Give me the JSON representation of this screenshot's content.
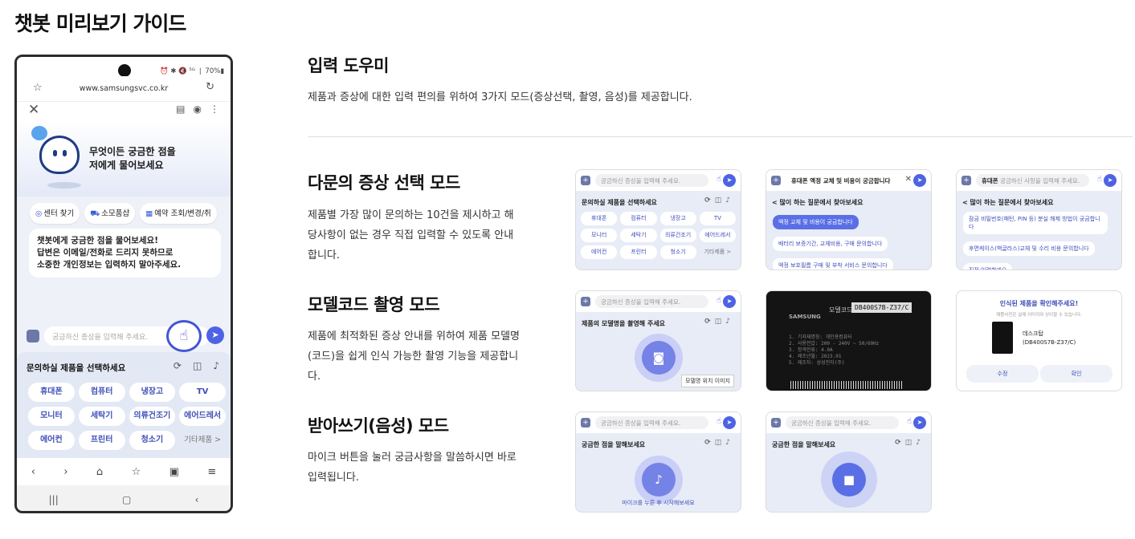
{
  "page_title": "챗봇 미리보기 가이드",
  "phone": {
    "status_right": "⏰ ✱ 🔇 ⁵ᴳ ❘ 70%▮",
    "url": "www.samsungsvc.co.kr",
    "hero_text_1": "무엇이든 궁금한 점을",
    "hero_text_2": "저에게 물어보세요",
    "quick_chips": [
      "센터 찾기",
      "소모품샵",
      "예약 조회/변경/취"
    ],
    "bot_message_1": "챗봇에게 궁금한 점을 물어보세요!",
    "bot_message_2": "답변은 이메일/전화로 드리지 못하므로",
    "bot_message_3": "소중한 개인정보는 입력하지 말아주세요.",
    "input_placeholder": "궁금하신 증상을 입력해 주세요.",
    "panel_title": "문의하실 제품을 선택하세요",
    "products": [
      "휴대폰",
      "컴퓨터",
      "냉장고",
      "TV",
      "모니터",
      "세탁기",
      "의류건조기",
      "에어드레서",
      "에어컨",
      "프린터",
      "청소기",
      "기타제품 >"
    ]
  },
  "sections": {
    "input_helper": {
      "title": "입력 도우미",
      "desc": "제품과 증상에 대한 입력 편의를 위하여 3가지 모드(증상선택, 촬영, 음성)를 제공합니다."
    },
    "symptom_mode": {
      "title": "다문의 증상 선택 모드",
      "desc": "제품별 가장 많이 문의하는 10건을 제시하고 해당사항이 없는 경우 직접 입력할 수 있도록 안내합니다."
    },
    "model_mode": {
      "title": "모델코드 촬영 모드",
      "desc": "제품에 최적화된 증상 안내를 위하여 제품 모델명(코드)을 쉽게 인식 가능한 촬영 기능을 제공합니다."
    },
    "voice_mode": {
      "title": "받아쓰기(음성) 모드",
      "desc": "마이크 버튼을 눌러 궁금사항을 말씀하시면 바로 입력됩니다."
    }
  },
  "cards": {
    "placeholder": "궁금하신 증상을 입력해 주세요.",
    "placeholder_question": "궁금하신 사항을 입력해 주세요.",
    "select_product": "문의하실 제품을 선택하세요",
    "products": [
      "휴대폰",
      "컴퓨터",
      "냉장고",
      "TV",
      "모니터",
      "세탁기",
      "의류건조기",
      "에어드레서",
      "에어컨",
      "프린터",
      "청소기",
      "기타제품 >"
    ],
    "card2_query": "휴대폰 액정 교체 및 비용이 궁금합니다",
    "faq_title": "< 많이 하는 질문에서 찾아보세요",
    "card2_items": [
      "액정 교체 및 비용이 궁금합니다",
      "배터리 보증기간, 교체비용, 구매 문의합니다",
      "액정 보호필름 구매 및 부착 서비스 문의합니다"
    ],
    "card3_prefix": "휴대폰",
    "card3_items": [
      "잠금 비밀번호(패턴, PIN 등) 분실 해제 방법이 궁금합니다",
      "후면케이스(백글라스)교체 및 수리 비용 문의합니다",
      "직접 입력할게요"
    ],
    "model_title": "제품의 모델명을 촬영해 주세요",
    "model_tag": "모델명 위치 이미지",
    "photo_label": "모델코드",
    "photo_code": "DB400S7B-Z37/C",
    "photo_brand": "SAMSUNG",
    "photo_specs": "1. 기자재명칭: 개인용컴퓨터\n2. 사용전압: 200 - 240V ~ 50/60Hz\n3. 정격전류: 4.0A\n4. 제조년월: 2023.01\n5. 제조자: 삼성전자(주)",
    "confirm_title": "인식된 제품을 확인해주세요!",
    "confirm_sub": "제품사진은 실제 이미지와 상이할 수 있습니다.",
    "confirm_product": "데스크탑",
    "confirm_code": "(DB400S7B-Z37/C)",
    "confirm_btn_edit": "수정",
    "confirm_btn_ok": "확인",
    "voice_title": "궁금한 점을 말해보세요",
    "voice_caption": "마이크를 누른 후 시작해보세요"
  }
}
